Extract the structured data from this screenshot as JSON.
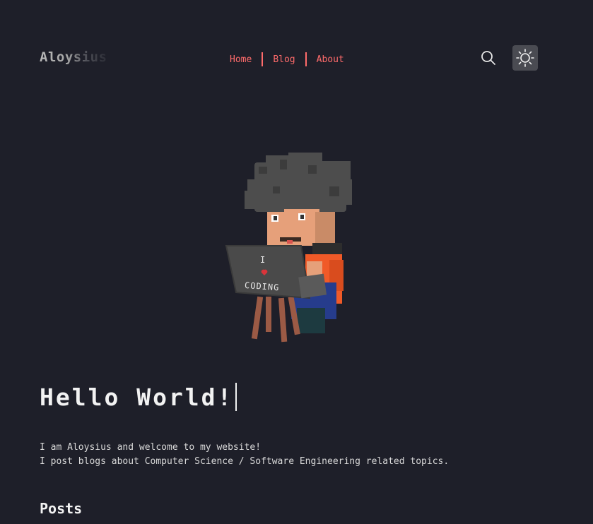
{
  "site": {
    "logo": "Aloysius"
  },
  "nav": {
    "items": [
      "Home",
      "Blog",
      "About"
    ]
  },
  "icons": {
    "search": "search-icon",
    "theme": "sun-icon"
  },
  "avatar": {
    "laptop_text_line1": "I",
    "laptop_text_line2": "CODING"
  },
  "hero": {
    "title": "Hello World!",
    "intro_line1": "I am Aloysius and welcome to my website!",
    "intro_line2": "I post blogs about Computer Science / Software Engineering related topics."
  },
  "posts": {
    "heading": "Posts"
  },
  "colors": {
    "background": "#1e1f29",
    "accent": "#ff6b6b",
    "text": "#e6e6e6"
  }
}
